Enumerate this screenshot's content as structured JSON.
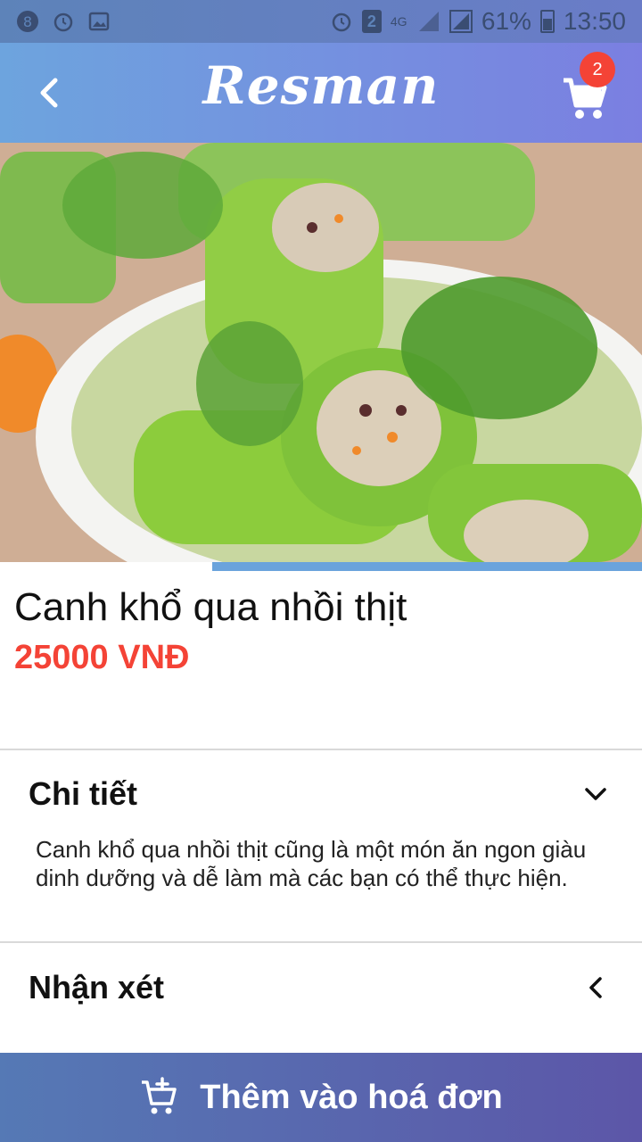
{
  "status_bar": {
    "battery": "61%",
    "time": "13:50",
    "network": "4G",
    "sim_slot": "2"
  },
  "app_bar": {
    "title": "Resman",
    "cart_count": "2"
  },
  "dish": {
    "name": "Canh khổ qua nhồi thịt",
    "price": "25000 VNĐ",
    "gallery_progress": 0.67
  },
  "sections": {
    "details": {
      "title": "Chi tiết",
      "text": "Canh khổ qua nhồi thịt cũng là một món ăn ngon giàu dinh dưỡng và dễ làm mà các bạn có thể thực hiện."
    },
    "reviews": {
      "title": "Nhận xét"
    }
  },
  "actions": {
    "add_to_bill": "Thêm vào hoá đơn"
  },
  "colors": {
    "price": "#f44336",
    "badge": "#f44336",
    "accent": "#6aa3dc"
  }
}
